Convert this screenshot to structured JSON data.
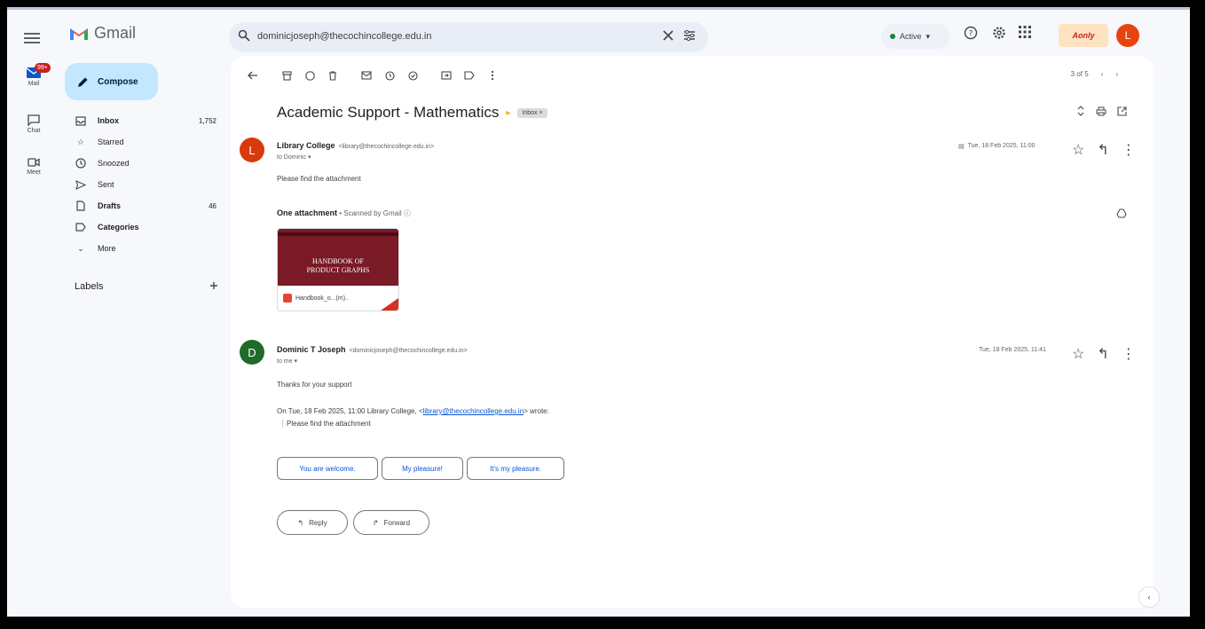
{
  "app": {
    "name": "Gmail"
  },
  "search": {
    "query": "dominicjoseph@thecochincollege.edu.in"
  },
  "header": {
    "status": "Active",
    "org_logo_text": "Aonly",
    "avatar_initial": "L"
  },
  "rail": {
    "mail_label": "Mail",
    "mail_badge": "99+",
    "chat_label": "Chat",
    "meet_label": "Meet"
  },
  "sidebar": {
    "compose_label": "Compose",
    "items": [
      {
        "label": "Inbox",
        "count": "1,752"
      },
      {
        "label": "Starred",
        "count": ""
      },
      {
        "label": "Snoozed",
        "count": ""
      },
      {
        "label": "Sent",
        "count": ""
      },
      {
        "label": "Drafts",
        "count": "46"
      },
      {
        "label": "Categories",
        "count": ""
      },
      {
        "label": "More",
        "count": ""
      }
    ],
    "labels_heading": "Labels"
  },
  "thread": {
    "pager": "3 of 5",
    "subject": "Academic Support - Mathematics",
    "label_chip": "Inbox ×",
    "messages": [
      {
        "avatar": "L",
        "sender": "Library College",
        "email": "<library@thecochincollege.edu.in>",
        "to": "to Dominic ▾",
        "date": "Tue, 18 Feb 2025, 11:00",
        "body": "Please find the attachment"
      },
      {
        "avatar": "D",
        "sender": "Dominic T Joseph",
        "email": "<dominicjoseph@thecochincollege.edu.in>",
        "to": "to me ▾",
        "date": "Tue, 18 Feb 2025, 11:41",
        "body": "Thanks for your support",
        "quote_prefix": "On Tue, 18 Feb 2025, 11:00 Library College, <",
        "quote_link": "library@thecochincollege.edu.in",
        "quote_suffix": "> wrote:",
        "quote_body": "Please find the attachment"
      }
    ],
    "attachment": {
      "heading": "One attachment",
      "subheading": " • Scanned by Gmail ⓘ",
      "thumb_title_line1": "HANDBOOK OF",
      "thumb_title_line2": "PRODUCT GRAPHS",
      "file_name": "Handbook_o...(m).."
    },
    "smart_replies": [
      "You are welcome.",
      "My pleasure!",
      "It's my pleasure."
    ],
    "reply_label": "Reply",
    "forward_label": "Forward"
  },
  "colors": {
    "accent": "#0b57d0",
    "compose_bg": "#c2e7ff",
    "avatar_l": "#d93a0b",
    "avatar_d": "#1e6b2a"
  }
}
